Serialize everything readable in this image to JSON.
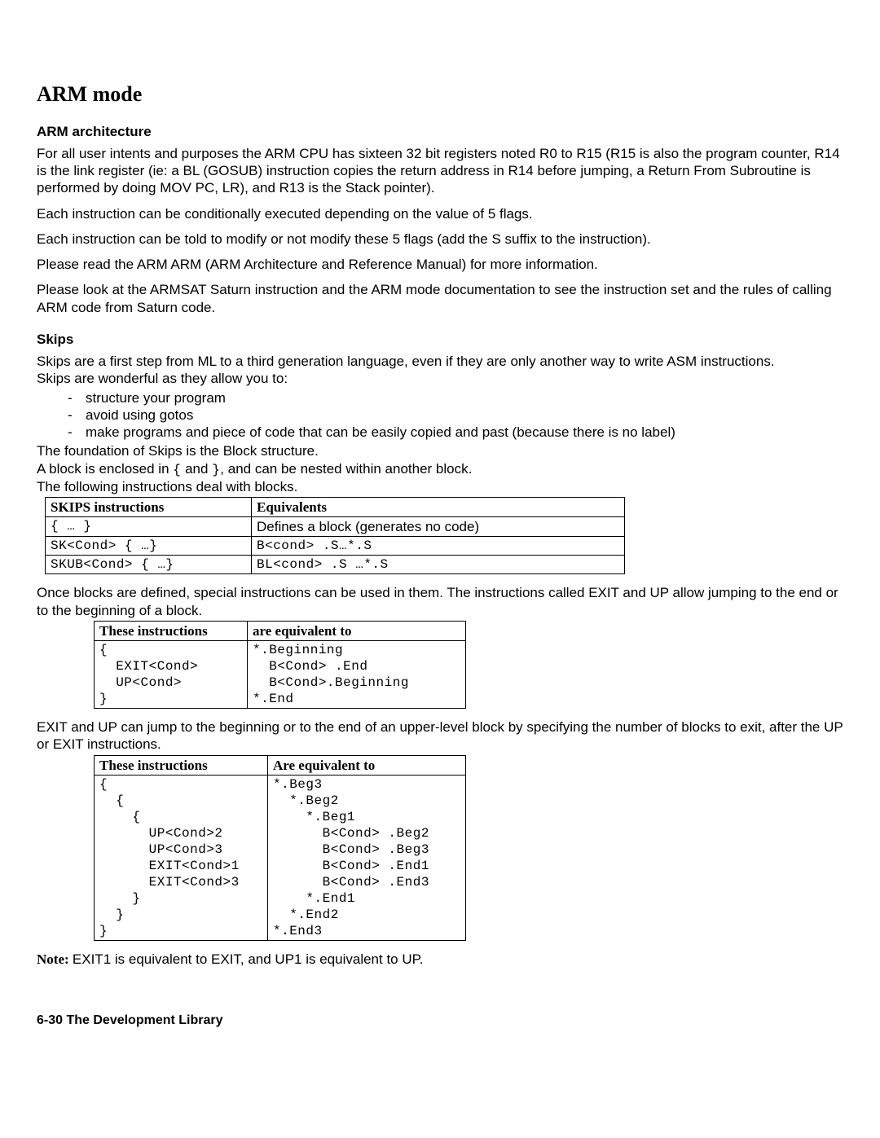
{
  "heading": "ARM mode",
  "arch": {
    "title": "ARM architecture",
    "p1": "For all user intents and purposes the ARM CPU has sixteen 32 bit registers noted R0 to R15 (R15 is also the program counter, R14 is the link register (ie: a BL (GOSUB) instruction copies the return address in R14 before jumping, a Return From Subroutine is performed by doing MOV PC, LR), and R13 is the Stack pointer).",
    "p2": "Each instruction can be conditionally executed depending on the value of 5 flags.",
    "p3": "Each instruction can be told to modify or not modify these 5 flags (add the S suffix to the instruction).",
    "p4": "Please read the ARM ARM (ARM Architecture and Reference Manual) for more information.",
    "p5": "Please look at the ARMSAT Saturn instruction and the ARM mode documentation to see the instruction set and the rules of calling ARM code from Saturn code."
  },
  "skips": {
    "title": "Skips",
    "p1": "Skips are a first step from ML to a third generation language, even if they are only another way to write ASM instructions.",
    "p2": "Skips are wonderful as they allow you to:",
    "bullets": [
      "structure your program",
      "avoid using gotos",
      "make programs and piece of code that can be easily copied and past (because there is no label)"
    ],
    "p3a": "The foundation of Skips is the Block structure.",
    "p3b_pre": "A block is enclosed in ",
    "p3b_c1": "{",
    "p3b_mid": " and ",
    "p3b_c2": "}",
    "p3b_post": ", and can be nested within another block.",
    "p4": "The following instructions deal with blocks."
  },
  "table1": {
    "h1": "SKIPS instructions",
    "h2": "Equivalents",
    "r1c1": "{ … }",
    "r1c2": "Defines a block (generates no code)",
    "r2c1": "SK<Cond> { …}",
    "r2c2_a": "B<cond> .S…",
    "r2c2_b": "*.S",
    "r3c1": "SKUB<Cond> { …}",
    "r3c2_a": "BL<cond> .S …",
    "r3c2_b": "*.S"
  },
  "mid_p": "Once blocks are defined, special instructions can be used in them. The instructions called EXIT and UP allow jumping to the end or to the beginning of a block.",
  "table2": {
    "h1": "These instructions",
    "h2": "are equivalent to",
    "c1": "{\n  EXIT<Cond>\n  UP<Cond>\n}",
    "c2": "*.Beginning\n  B<Cond> .End\n  B<Cond>.Beginning\n*.End"
  },
  "mid_p2": "EXIT and UP can jump to the beginning or to the end of an upper-level block by specifying the number of blocks to exit, after the UP or EXIT instructions.",
  "table3": {
    "h1": "These instructions",
    "h2": "Are equivalent to",
    "c1": "{\n  {\n    {\n      UP<Cond>2\n      UP<Cond>3\n      EXIT<Cond>1\n      EXIT<Cond>3\n    }\n  }\n}",
    "c2": "*.Beg3\n  *.Beg2\n    *.Beg1\n      B<Cond> .Beg2\n      B<Cond> .Beg3\n      B<Cond> .End1\n      B<Cond> .End3\n    *.End1\n  *.End2\n*.End3"
  },
  "note_label": "Note: ",
  "note_text": "EXIT1 is equivalent to EXIT, and UP1 is equivalent to UP.",
  "footer": "6-30   The Development Library"
}
